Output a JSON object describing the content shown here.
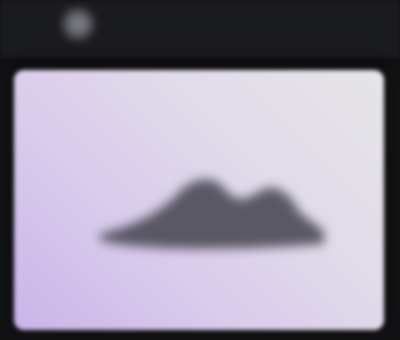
{
  "header": {
    "title": ""
  },
  "content": {
    "caption": ""
  },
  "colors": {
    "header_bg": "#1a1b1f",
    "page_bg": "#131315",
    "card_gradient_start": "#cbb4ea",
    "card_gradient_end": "#e6e5e8",
    "graphic": "#4a4a55"
  },
  "icons": {
    "logo": "logo-icon",
    "illustration": "illustration-graphic"
  }
}
